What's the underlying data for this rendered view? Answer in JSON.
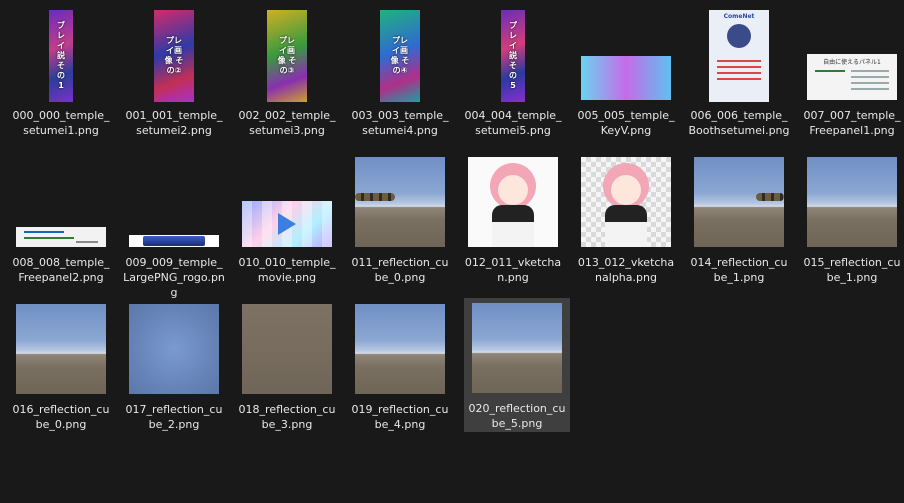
{
  "files": [
    {
      "name": "000_000_temple_setumei1.png",
      "thumb_text": "ブレイ説 その1"
    },
    {
      "name": "001_001_temple_setumei2.png",
      "thumb_text": "プレイ画像 その②"
    },
    {
      "name": "002_002_temple_setumei3.png",
      "thumb_text": "プレイ画像 その③"
    },
    {
      "name": "003_003_temple_setumei4.png",
      "thumb_text": "プレイ画像 その④"
    },
    {
      "name": "004_004_temple_setumei5.png",
      "thumb_text": "プレイ説 その5"
    },
    {
      "name": "005_005_temple_KeyV.png"
    },
    {
      "name": "006_006_temple_Boothsetumei.png",
      "thumb_text": "ComeNet"
    },
    {
      "name": "007_007_temple_Freepanel1.png",
      "thumb_text": "自由に使えるパネル1"
    },
    {
      "name": "008_008_temple_Freepanel2.png"
    },
    {
      "name": "009_009_temple_LargePNG_rogo.png"
    },
    {
      "name": "010_010_temple_movie.png"
    },
    {
      "name": "011_reflection_cube_0.png"
    },
    {
      "name": "012_011_vketchan.png"
    },
    {
      "name": "013_012_vketchanalpha.png"
    },
    {
      "name": "014_reflection_cube_1.png"
    },
    {
      "name": "015_reflection_cube_1.png"
    },
    {
      "name": "016_reflection_cube_0.png"
    },
    {
      "name": "017_reflection_cube_2.png"
    },
    {
      "name": "018_reflection_cube_3.png"
    },
    {
      "name": "019_reflection_cube_4.png"
    },
    {
      "name": "020_reflection_cube_5.png"
    }
  ],
  "selected_file": "020_reflection_cube_5.png",
  "colors": {
    "background": "#191919",
    "selection": "#3f3f3f",
    "label_text": "#e8e8e8"
  }
}
